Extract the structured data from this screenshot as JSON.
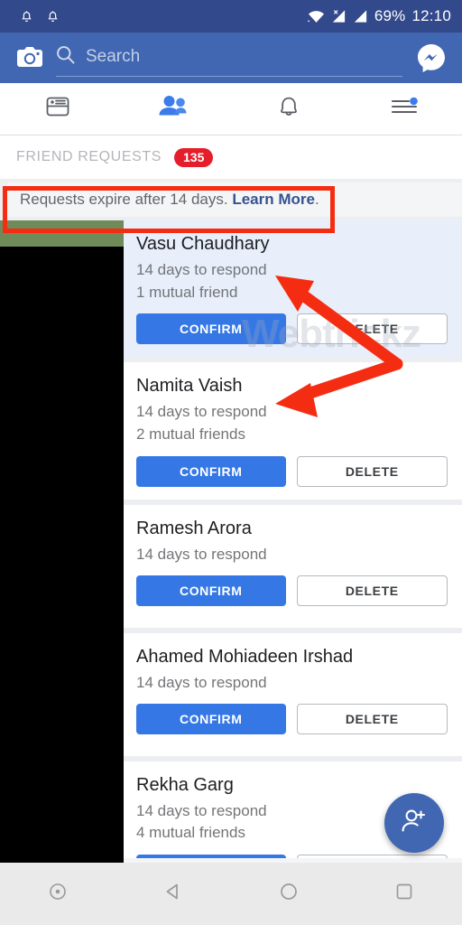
{
  "status_bar": {
    "icons": [
      "bell-icon",
      "bell-icon"
    ],
    "wifi": "wifi-icon",
    "signal_no_sim": "signal-no-sim-icon",
    "signal": "signal-icon",
    "battery": "69%",
    "time": "12:10"
  },
  "app_bar": {
    "camera": "camera-icon",
    "search_placeholder": "Search",
    "search_value": "",
    "messenger": "messenger-icon"
  },
  "tabs": [
    {
      "name": "news-feed",
      "icon": "news-feed-icon",
      "active": false
    },
    {
      "name": "friends",
      "icon": "friends-icon",
      "active": true
    },
    {
      "name": "notifications",
      "icon": "bell-icon",
      "active": false
    },
    {
      "name": "menu",
      "icon": "menu-icon",
      "active": false,
      "has_badge": true
    }
  ],
  "section": {
    "title": "FRIEND REQUESTS",
    "count": "135"
  },
  "banner": {
    "text": "Requests expire after 14 days.",
    "link": "Learn More",
    "period": "."
  },
  "buttons": {
    "confirm": "CONFIRM",
    "delete": "DELETE"
  },
  "requests": [
    {
      "name": "Vasu Chaudhary",
      "expires": "14 days to respond",
      "mutual": "1 mutual friend",
      "highlighted": true
    },
    {
      "name": "Namita Vaish",
      "expires": "14 days to respond",
      "mutual": "2 mutual friends",
      "highlighted": false
    },
    {
      "name": "Ramesh Arora",
      "expires": "14 days to respond",
      "mutual": "",
      "highlighted": false
    },
    {
      "name": "Ahamed Mohiadeen Irshad",
      "expires": "14 days to respond",
      "mutual": "",
      "highlighted": false
    },
    {
      "name": "Rekha Garg",
      "expires": "14 days to respond",
      "mutual": "4 mutual friends",
      "highlighted": false
    }
  ],
  "fab": {
    "icon": "add-person-icon"
  },
  "watermark": "Webtrickz",
  "annotations": {
    "highlight_color": "#f42d12",
    "arrow_color": "#f42d12",
    "redaction_color": "#000000"
  },
  "nav_bar": {
    "items": [
      {
        "name": "assistant-button",
        "icon": "circle-dot-icon"
      },
      {
        "name": "back-button",
        "icon": "triangle-back-icon"
      },
      {
        "name": "home-button",
        "icon": "circle-home-icon"
      },
      {
        "name": "recents-button",
        "icon": "square-recents-icon"
      }
    ]
  },
  "colors": {
    "fb_blue": "#4267b2",
    "status_bar": "#32498c",
    "confirm_blue": "#3578e5",
    "badge_red": "#e41e2b",
    "highlight_row": "#e8eefa"
  }
}
